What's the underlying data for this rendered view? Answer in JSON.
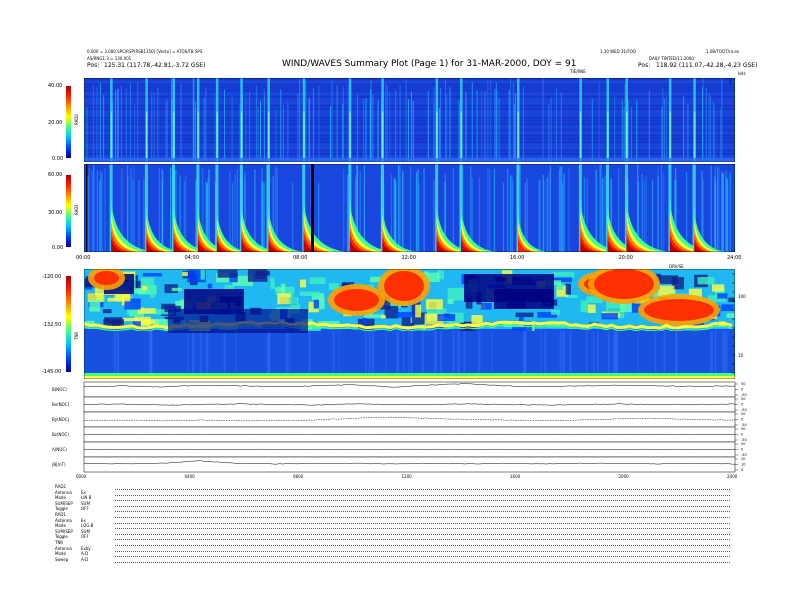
{
  "header": {
    "title": "WIND/WAVES Summary Plot (Page 1) for 31-MAR-2000, DOY = 91",
    "left_line1": "0.000 = 3.000 SPC/RSP(RSB1350) [Vecto] = ATOS/FB SPS",
    "left_line2": "AS/RNG1.3 = 130.001",
    "left_pos_label": "Pos:",
    "left_pos_value": "125.31 (117.78,-42.81,-3.72 GSE)",
    "right_line1": "1.10 WED 31/FOO",
    "right_line2": "DAILY TINTED/11.2000",
    "right_line3": "1.0B/TOOT/ra.ex",
    "right_pos_label": "Pos:",
    "right_pos_value": "118.92 (111.07,-42.28,-4.23 GSE)",
    "tnr_tag": "TIE/RNE",
    "khz_tag": "kHz",
    "drvm_tag": "DRV/SE"
  },
  "panels": {
    "rad2": {
      "label": "RAD2",
      "ticks": [
        "40.00",
        "20.00",
        "0.00"
      ],
      "right_ticks": [
        "0"
      ]
    },
    "rad1": {
      "label": "RAD1",
      "ticks": [
        "60.00",
        "30.00",
        "0.00"
      ]
    },
    "tnr": {
      "label": "TNR",
      "ticks": [
        "-120.00",
        "-132.50",
        "-145.00"
      ],
      "right_ticks": [
        "100",
        "10"
      ]
    }
  },
  "time_axis": {
    "upper": [
      "00:00",
      "04:00",
      "08:00",
      "12:00",
      "16:00",
      "20:00",
      "24:00"
    ],
    "lower": [
      "0000",
      "0400",
      "0800",
      "1200",
      "1600",
      "2000",
      "2400"
    ]
  },
  "mag": {
    "rows": [
      {
        "label": "B(NOC)",
        "ticks": [
          "50",
          "0",
          "-50"
        ]
      },
      {
        "label": "Bx(NOC)",
        "ticks": [
          "50",
          "0",
          "-50"
        ]
      },
      {
        "label": "By(NOC)",
        "ticks": [
          "50",
          "0",
          "-50"
        ]
      },
      {
        "label": "Bz(NOC)",
        "ticks": [
          "50",
          "0",
          "-50"
        ]
      },
      {
        "label": "Λ(NOC)",
        "ticks": [
          "50",
          "0",
          "-50"
        ]
      },
      {
        "label": "|B|(nT)",
        "ticks": [
          "20",
          "10",
          "0"
        ]
      }
    ]
  },
  "status": [
    {
      "label": "RAD2",
      "value": ""
    },
    {
      "label": "Antenna",
      "value": "Ex"
    },
    {
      "label": "Mode",
      "value": "LIN B"
    },
    {
      "label": "SUM/SEP",
      "value": "SUM"
    },
    {
      "label": "Toggle",
      "value": "OFF"
    },
    {
      "label": "RAD1",
      "value": ""
    },
    {
      "label": "Antenna",
      "value": "Ex"
    },
    {
      "label": "Mode",
      "value": "LOG-B"
    },
    {
      "label": "SUM/SEP",
      "value": "SUM"
    },
    {
      "label": "Toggle",
      "value": "OFF"
    },
    {
      "label": "TNR",
      "value": ""
    },
    {
      "label": "Antenna",
      "value": "Exby"
    },
    {
      "label": "Mode",
      "value": "A-D"
    },
    {
      "label": "Sweep",
      "value": "A-D"
    }
  ],
  "chart_data": [
    {
      "type": "heatmap",
      "title": "RAD2",
      "xlabel": "",
      "ylabel": "RAD2",
      "colorbar_ticks": [
        "40.00",
        "20.00",
        "0.00"
      ],
      "xlim": [
        "00:00",
        "24:00"
      ],
      "burst_times_hours": [
        1.0,
        2.3,
        3.3,
        4.2,
        4.9,
        5.8,
        6.8,
        8.1,
        9.8,
        11.0,
        13.0,
        13.9,
        16.0,
        18.3,
        19.3,
        20.0,
        21.6,
        22.5
      ]
    },
    {
      "type": "heatmap",
      "title": "RAD1",
      "xlabel": "",
      "ylabel": "RAD1",
      "colorbar_ticks": [
        "60.00",
        "30.00",
        "0.00"
      ],
      "xlim": [
        "00:00",
        "24:00"
      ],
      "burst_times_hours": [
        1.0,
        2.3,
        3.3,
        4.2,
        4.9,
        5.8,
        6.8,
        8.1,
        9.8,
        11.0,
        13.0,
        13.9,
        16.0,
        18.3,
        19.3,
        20.0,
        21.6,
        22.5
      ],
      "burst_strength": [
        0.9,
        0.6,
        0.7,
        0.6,
        0.5,
        0.7,
        0.6,
        0.9,
        0.9,
        0.6,
        0.7,
        0.6,
        0.4,
        0.9,
        0.7,
        0.9,
        0.9,
        0.5
      ]
    },
    {
      "type": "heatmap",
      "title": "TNR",
      "xlabel": "",
      "ylabel": "TNR",
      "colorbar_ticks": [
        "-120.00",
        "-132.50",
        "-145.00"
      ],
      "xlim": [
        "00:00",
        "24:00"
      ],
      "right_axis_ticks": [
        "100",
        "10"
      ]
    },
    {
      "type": "line",
      "title": "Magnetic field",
      "series": [
        {
          "name": "B(NOC)",
          "values": [
            0.25,
            0.3,
            0.2,
            0.35,
            0.3,
            0.25,
            0.3,
            0.4,
            0.2,
            0.35,
            0.5,
            0.3,
            0.25,
            0.3,
            0.35,
            0.3,
            0.25,
            0.3
          ]
        },
        {
          "name": "Bx(NOC)",
          "values": [
            0,
            0.05,
            -0.05,
            0,
            0.05,
            0,
            -0.05,
            0.05,
            0,
            0,
            0.05,
            0,
            -0.05,
            0,
            0.05,
            0,
            0,
            0.05
          ]
        },
        {
          "name": "By(NOC)",
          "values": [
            -0.1,
            -0.05,
            -0.1,
            -0.05,
            -0.1,
            -0.1,
            -0.05,
            0.1,
            0.2,
            0.1,
            0,
            -0.05,
            -0.1,
            -0.05,
            0.05,
            0.1,
            0,
            -0.05
          ]
        },
        {
          "name": "Bz(NOC)",
          "values": [
            0,
            0,
            0,
            0,
            0,
            0,
            0,
            0,
            0,
            0,
            0,
            0,
            0,
            0,
            0,
            0,
            0,
            0
          ]
        },
        {
          "name": "Λ(NOC)",
          "values": [
            0,
            0,
            0,
            0,
            0,
            0,
            0,
            0,
            0,
            0,
            0,
            0,
            0,
            0,
            0,
            0,
            0,
            0
          ]
        },
        {
          "name": "|B|(nT)",
          "values": [
            0.1,
            0.05,
            0.1,
            0.3,
            0.1,
            0.05,
            0.1,
            0.1,
            0.05,
            0.1,
            0.05,
            0.1,
            0.05,
            0.1,
            0.1,
            0.05,
            0.1,
            0.05
          ]
        }
      ]
    }
  ]
}
